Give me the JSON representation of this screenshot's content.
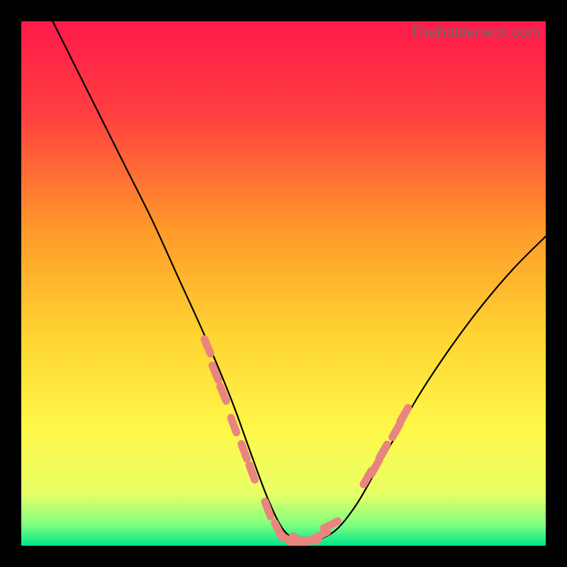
{
  "watermark": "TheBottleneck.com",
  "chart_data": {
    "type": "line",
    "title": "",
    "xlabel": "",
    "ylabel": "",
    "xlim": [
      0,
      100
    ],
    "ylim": [
      0,
      100
    ],
    "grid": false,
    "legend": false,
    "background_gradient": {
      "stops": [
        {
          "offset": 0.0,
          "color": "#ff1a4a"
        },
        {
          "offset": 0.18,
          "color": "#ff4040"
        },
        {
          "offset": 0.4,
          "color": "#ff9a2a"
        },
        {
          "offset": 0.6,
          "color": "#ffd433"
        },
        {
          "offset": 0.78,
          "color": "#fff84a"
        },
        {
          "offset": 0.9,
          "color": "#e8ff67"
        },
        {
          "offset": 0.96,
          "color": "#7fff7f"
        },
        {
          "offset": 1.0,
          "color": "#00e58a"
        }
      ]
    },
    "curve": {
      "name": "bottleneck-curve",
      "x": [
        6,
        10,
        15,
        20,
        25,
        30,
        35,
        40,
        44,
        47,
        50,
        53,
        56,
        60,
        64,
        68,
        72,
        76,
        82,
        88,
        94,
        100
      ],
      "y": [
        100,
        92,
        82,
        72,
        62,
        51,
        40,
        28,
        17,
        9,
        3,
        1,
        1,
        3,
        8,
        15,
        22,
        29,
        38,
        46,
        53,
        59
      ]
    },
    "markers": {
      "name": "highlight-points",
      "color": "#e9857e",
      "points": [
        {
          "x": 35.5,
          "y": 38
        },
        {
          "x": 37.0,
          "y": 33
        },
        {
          "x": 38.5,
          "y": 29
        },
        {
          "x": 40.5,
          "y": 23
        },
        {
          "x": 42.5,
          "y": 18
        },
        {
          "x": 44.0,
          "y": 14
        },
        {
          "x": 47.0,
          "y": 7
        },
        {
          "x": 49.0,
          "y": 3
        },
        {
          "x": 51.0,
          "y": 1
        },
        {
          "x": 53.0,
          "y": 1
        },
        {
          "x": 55.0,
          "y": 1
        },
        {
          "x": 57.0,
          "y": 2
        },
        {
          "x": 59.0,
          "y": 4
        },
        {
          "x": 66.0,
          "y": 13
        },
        {
          "x": 67.5,
          "y": 15
        },
        {
          "x": 69.0,
          "y": 18
        },
        {
          "x": 71.5,
          "y": 22
        },
        {
          "x": 73.0,
          "y": 25
        }
      ]
    }
  }
}
